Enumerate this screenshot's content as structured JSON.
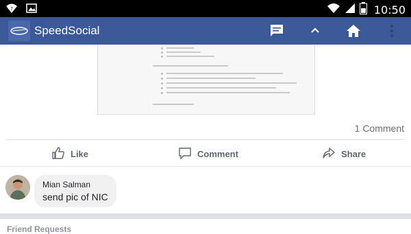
{
  "status_bar": {
    "time": "10:50",
    "icons": [
      "help-wifi-icon",
      "image-icon",
      "wifi-icon",
      "signal-icon",
      "battery-icon"
    ]
  },
  "app_bar": {
    "title": "SpeedSocial",
    "logo_icon": "speedsocial-logo",
    "actions": [
      "messages-icon",
      "chevron-up-icon",
      "home-icon",
      "overflow-menu-icon"
    ],
    "color": "#3b5998"
  },
  "post": {
    "comment_count": "1 Comment",
    "actions": {
      "like": "Like",
      "comment": "Comment",
      "share": "Share"
    }
  },
  "comment": {
    "author": "Mian Salman",
    "text": "send pic of NIC"
  },
  "friend_requests": {
    "title": "Friend Requests"
  }
}
